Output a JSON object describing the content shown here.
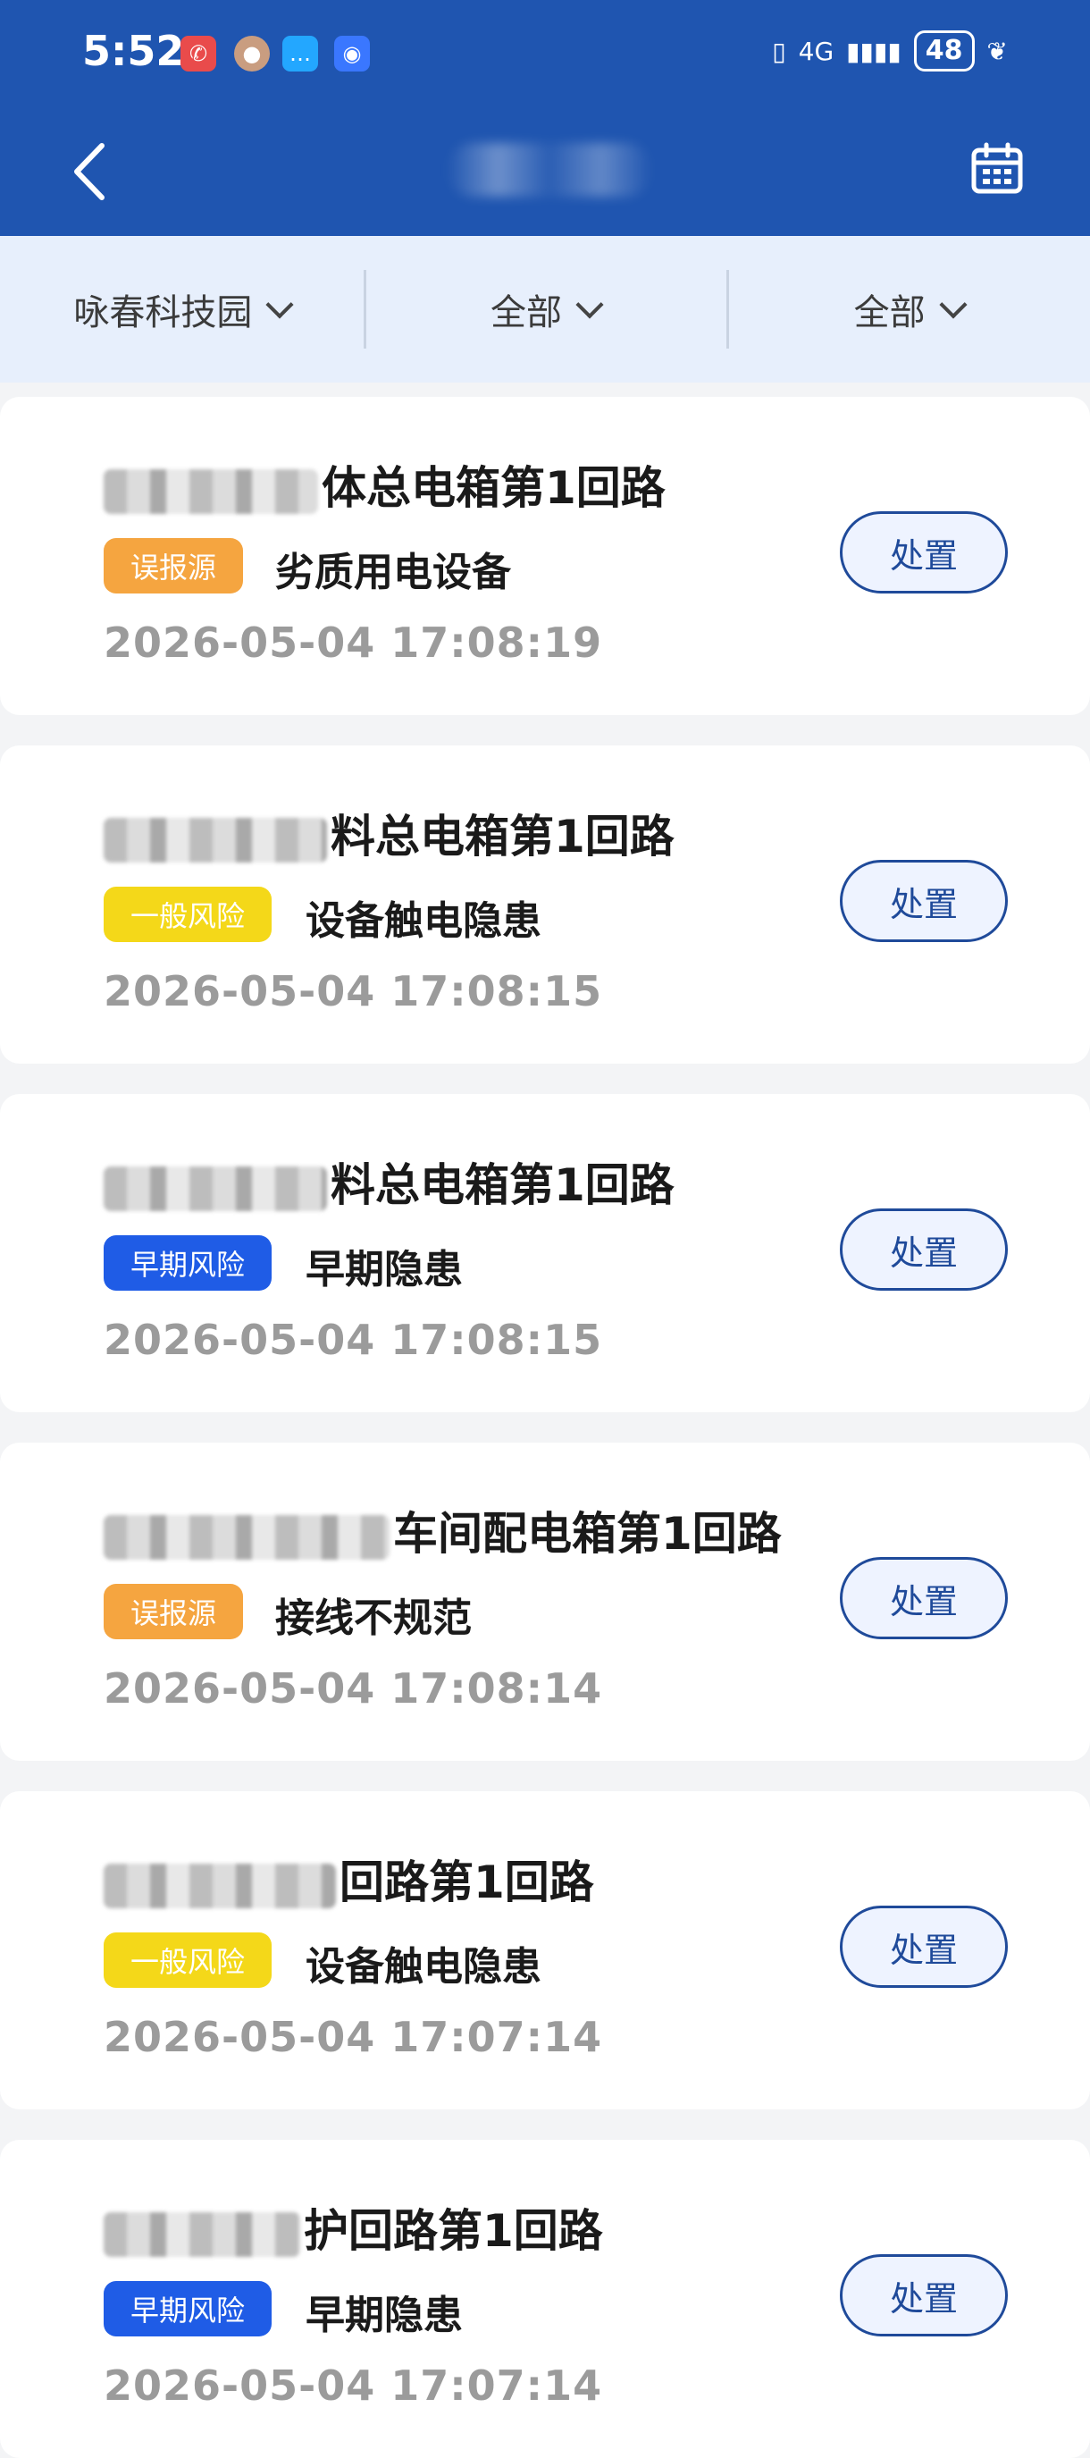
{
  "status_bar": {
    "time": "5:52",
    "network": "4G",
    "battery": "48",
    "notification_icons": [
      "missed-call-icon",
      "avatar-icon",
      "chat-icon",
      "shield-icon"
    ]
  },
  "header": {
    "title": "",
    "back_icon": "back-arrow-icon",
    "calendar_icon": "calendar-icon"
  },
  "filters": [
    {
      "label": "咏春科技园"
    },
    {
      "label": "全部"
    },
    {
      "label": "全部"
    }
  ],
  "action_label": "处置",
  "items": [
    {
      "title_visible": "体总电箱第1回路",
      "tag": "误报源",
      "tag_color": "#f5a540",
      "type": "劣质用电设备",
      "time": "2026-05-04 17:08:19"
    },
    {
      "title_visible": "料总电箱第1回路",
      "tag": "一般风险",
      "tag_color": "#f4d819",
      "type": "设备触电隐患",
      "time": "2026-05-04 17:08:15"
    },
    {
      "title_visible": "料总电箱第1回路",
      "tag": "早期风险",
      "tag_color": "#1f5ce6",
      "type": "早期隐患",
      "time": "2026-05-04 17:08:15"
    },
    {
      "title_visible": "车间配电箱第1回路",
      "tag": "误报源",
      "tag_color": "#f5a540",
      "type": "接线不规范",
      "time": "2026-05-04 17:08:14"
    },
    {
      "title_visible": "回路第1回路",
      "tag": "一般风险",
      "tag_color": "#f4d819",
      "type": "设备触电隐患",
      "time": "2026-05-04 17:07:14"
    },
    {
      "title_visible": "护回路第1回路",
      "tag": "早期风险",
      "tag_color": "#1f5ce6",
      "type": "早期隐患",
      "time": "2026-05-04 17:07:14"
    }
  ]
}
